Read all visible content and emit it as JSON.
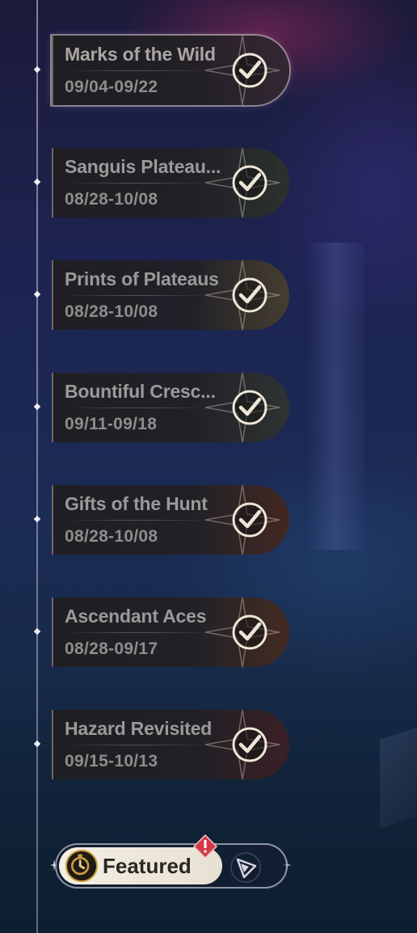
{
  "events": [
    {
      "title": "Marks of the Wild",
      "date": "09/04-09/22",
      "art": "#3a2c40"
    },
    {
      "title": "Sanguis Plateau...",
      "date": "08/28-10/08",
      "art": "#2d3e36"
    },
    {
      "title": "Prints of Plateaus",
      "date": "08/28-10/08",
      "art": "#5e5438"
    },
    {
      "title": "Bountiful Cresc...",
      "date": "09/11-09/18",
      "art": "#34423e"
    },
    {
      "title": "Gifts of the Hunt",
      "date": "08/28-10/08",
      "art": "#5a2a1e"
    },
    {
      "title": "Ascendant Aces",
      "date": "08/28-09/17",
      "art": "#5a3220"
    },
    {
      "title": "Hazard Revisited",
      "date": "09/15-10/13",
      "art": "#4a1e28"
    }
  ],
  "featured": {
    "label": "Featured"
  },
  "colors": {
    "accent": "#c89b3b",
    "alert": "#d23a4a",
    "check": "#ece6d6"
  }
}
